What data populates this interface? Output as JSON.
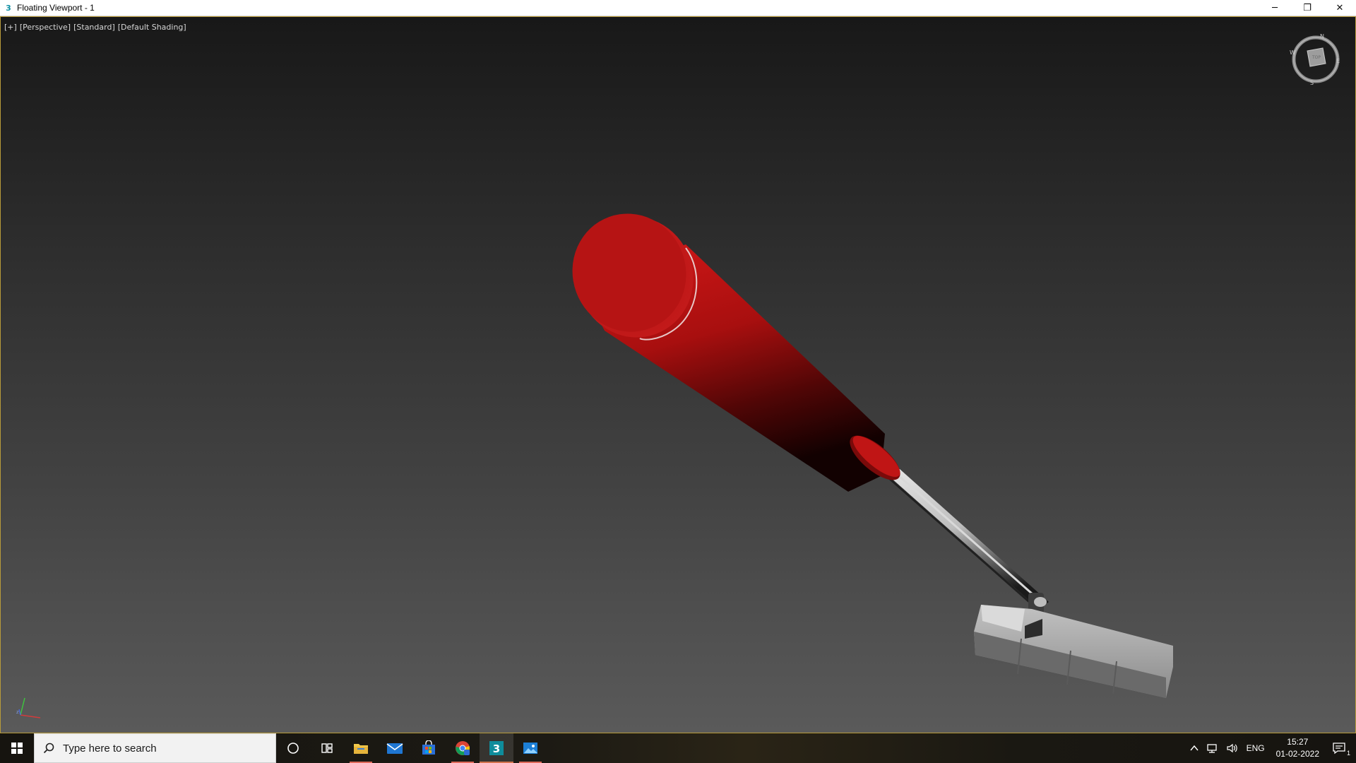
{
  "window": {
    "title": "Floating Viewport - 1",
    "app_icon_glyph": "3",
    "minimize_glyph": "─",
    "restore_glyph": "❐",
    "close_glyph": "✕"
  },
  "viewport": {
    "labels": [
      "[+]",
      "[Perspective]",
      "[Standard]",
      "[Default Shading]"
    ],
    "viewcube": {
      "face_label": "TOP",
      "compass": {
        "north": "N",
        "south": "S",
        "east": "E",
        "west": "W"
      }
    },
    "axis": {
      "x": "x",
      "y": "y",
      "z": "z"
    },
    "scene_object": "golf-putter",
    "colors": {
      "grip": "#b01414",
      "shaft": "#c8c8c8",
      "head": "#9a9a9a"
    }
  },
  "taskbar": {
    "search_placeholder": "Type here to search",
    "apps": [
      {
        "name": "cortana-icon",
        "active": false,
        "running": false
      },
      {
        "name": "task-view-icon",
        "active": false,
        "running": false
      },
      {
        "name": "file-explorer-icon",
        "active": false,
        "running": true
      },
      {
        "name": "mail-icon",
        "active": false,
        "running": false
      },
      {
        "name": "store-icon",
        "active": false,
        "running": false
      },
      {
        "name": "chrome-icon",
        "active": false,
        "running": true
      },
      {
        "name": "3dsmax-icon",
        "active": true,
        "running": true
      },
      {
        "name": "photos-icon",
        "active": false,
        "running": true
      }
    ],
    "tray": {
      "language": "ENG",
      "time": "15:27",
      "date": "01-02-2022",
      "notification_count": "1"
    }
  }
}
